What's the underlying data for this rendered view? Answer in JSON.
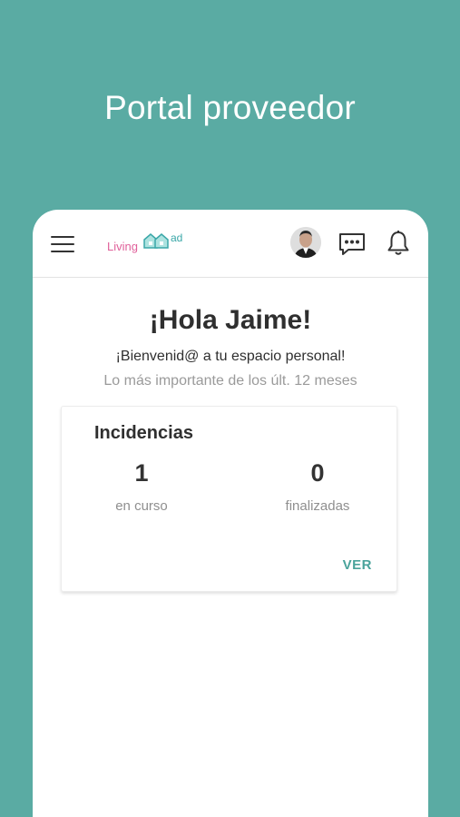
{
  "promo": {
    "title": "Portal proveedor"
  },
  "appbar": {
    "logo": {
      "part1": "Living",
      "part2": "ad"
    }
  },
  "home": {
    "greeting": "¡Hola Jaime!",
    "welcome": "¡Bienvenid@ a tu espacio personal!",
    "subtitle": "Lo más importante de los últ. 12 meses"
  },
  "incidencias": {
    "title": "Incidencias",
    "stats": [
      {
        "value": "1",
        "label": "en curso"
      },
      {
        "value": "0",
        "label": "finalizadas"
      }
    ],
    "action_label": "VER"
  },
  "colors": {
    "background": "#5aaba3",
    "accent": "#4aa39b",
    "logo_pink": "#e0609a",
    "logo_teal": "#3aa7a8"
  },
  "icons": [
    "menu-icon",
    "avatar",
    "chat-icon",
    "bell-icon"
  ]
}
